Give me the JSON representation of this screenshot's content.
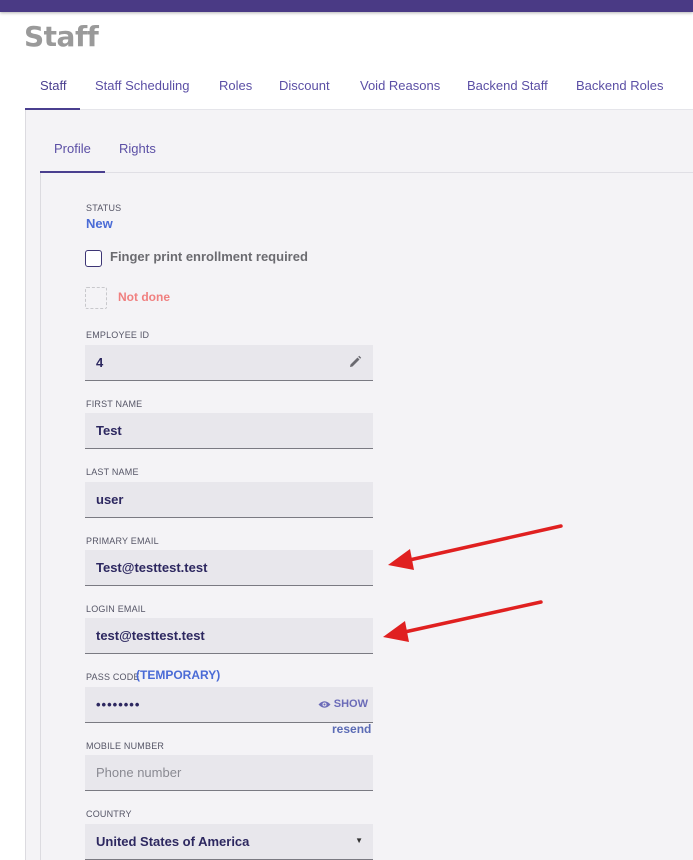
{
  "app": {
    "page_title": "Staff"
  },
  "tabs": [
    {
      "label": "Staff"
    },
    {
      "label": "Staff Scheduling"
    },
    {
      "label": "Roles"
    },
    {
      "label": "Discount"
    },
    {
      "label": "Void Reasons"
    },
    {
      "label": "Backend Staff"
    },
    {
      "label": "Backend Roles"
    }
  ],
  "subtabs": [
    {
      "label": "Profile"
    },
    {
      "label": "Rights"
    }
  ],
  "form": {
    "status_label": "STATUS",
    "status_value": "New",
    "fingerprint_checkbox_label": "Finger print enrollment required",
    "fingerprint_status": "Not done",
    "employee_id_label": "EMPLOYEE ID",
    "employee_id_value": "4",
    "first_name_label": "FIRST NAME",
    "first_name_value": "Test",
    "last_name_label": "LAST NAME",
    "last_name_value": "user",
    "primary_email_label": "PRIMARY EMAIL",
    "primary_email_value": "Test@testtest.test",
    "login_email_label": "LOGIN EMAIL",
    "login_email_value": "test@testtest.test",
    "pass_code_label": "PASS CODE",
    "pass_code_temp": "(TEMPORARY)",
    "pass_code_value": "••••••••",
    "show_label": "SHOW",
    "resend_label": "resend",
    "mobile_label": "MOBILE NUMBER",
    "mobile_placeholder": "Phone number",
    "country_label": "COUNTRY",
    "country_value": "United States of America"
  },
  "colors": {
    "topbar": "#4a3a85",
    "accent": "#4a3f8f",
    "status_blue": "#4a6bd6",
    "not_done": "#f08080",
    "annotation_arrow": "#e02020"
  }
}
